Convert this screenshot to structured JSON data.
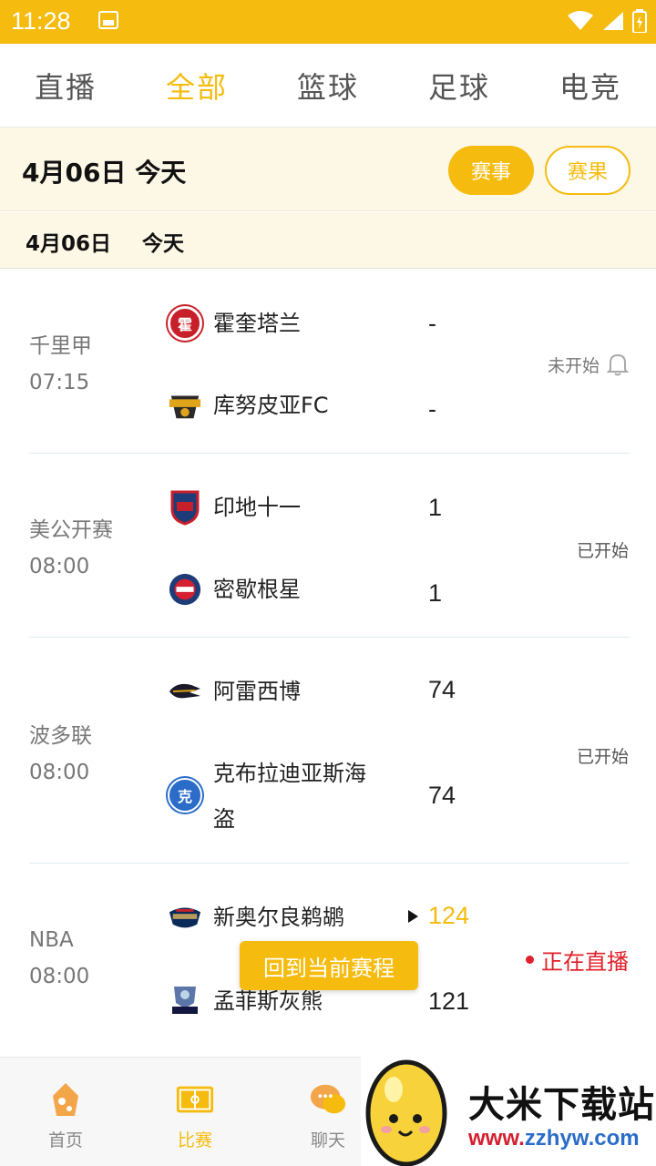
{
  "status_bar": {
    "time": "11:28"
  },
  "tabs": [
    {
      "label": "直播",
      "active": false
    },
    {
      "label": "全部",
      "active": true
    },
    {
      "label": "篮球",
      "active": false
    },
    {
      "label": "足球",
      "active": false
    },
    {
      "label": "电竞",
      "active": false
    }
  ],
  "date_header": {
    "title": "4月06日  今天",
    "events_button": "赛事",
    "results_button": "赛果"
  },
  "date_sub": {
    "date": "4月06日",
    "day": "今天"
  },
  "matches": [
    {
      "league": "千里甲",
      "time": "07:15",
      "home": "霍奎塔兰",
      "home_logo_text": "霍",
      "home_score": "-",
      "away": "库努皮亚FC",
      "away_score": "-",
      "status": "未开始"
    },
    {
      "league": "美公开赛",
      "time": "08:00",
      "home": "印地十一",
      "home_score": "1",
      "away": "密歇根星",
      "away_score": "1",
      "status": "已开始"
    },
    {
      "league": "波多联",
      "time": "08:00",
      "home": "阿雷西博",
      "home_score": "74",
      "away_line1": "克布拉迪亚斯海",
      "away_line2": "盗",
      "away_logo_text": "克",
      "away_score": "74",
      "status": "已开始"
    },
    {
      "league": "NBA",
      "time": "08:00",
      "home": "新奥尔良鹈鹕",
      "home_score": "124",
      "away": "孟菲斯灰熊",
      "away_score": "121",
      "status": "正在直播"
    }
  ],
  "float_button": "回到当前赛程",
  "bottom_nav": [
    {
      "label": "首页",
      "active": false
    },
    {
      "label": "比赛",
      "active": true
    },
    {
      "label": "聊天",
      "active": false
    }
  ],
  "watermark": {
    "title": "大米下载站",
    "url_parts": [
      "www.",
      "zzhyw",
      ".com"
    ]
  },
  "colors": {
    "accent": "#f5bb0e",
    "live": "#e0202a"
  }
}
